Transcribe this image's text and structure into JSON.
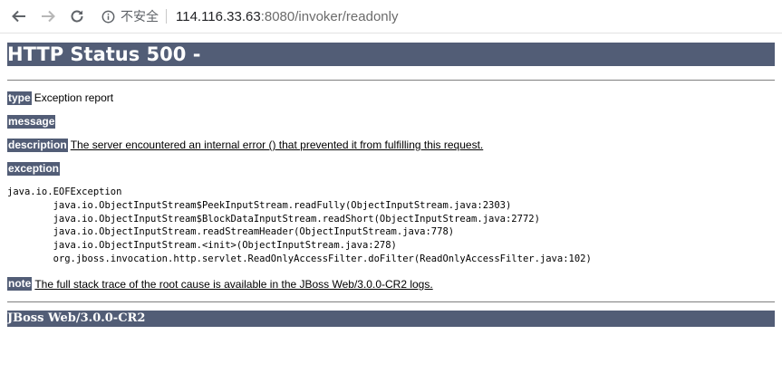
{
  "browser": {
    "back_icon": "arrow-left-icon",
    "forward_icon": "arrow-right-icon",
    "reload_icon": "reload-icon",
    "security_icon": "info-icon",
    "security_label": "不安全",
    "url_host": "114.116.33.63",
    "url_rest": ":8080/invoker/readonly"
  },
  "page": {
    "title": "HTTP Status 500 -",
    "type_label": "type",
    "type_value": "Exception report",
    "message_label": "message",
    "description_label": "description",
    "description_value": "The server encountered an internal error () that prevented it from fulfilling this request.",
    "exception_label": "exception",
    "stack_trace": [
      "java.io.EOFException",
      "\tjava.io.ObjectInputStream$PeekInputStream.readFully(ObjectInputStream.java:2303)",
      "\tjava.io.ObjectInputStream$BlockDataInputStream.readShort(ObjectInputStream.java:2772)",
      "\tjava.io.ObjectInputStream.readStreamHeader(ObjectInputStream.java:778)",
      "\tjava.io.ObjectInputStream.<init>(ObjectInputStream.java:278)",
      "\torg.jboss.invocation.http.servlet.ReadOnlyAccessFilter.doFilter(ReadOnlyAccessFilter.java:102)"
    ],
    "note_label": "note",
    "note_value": "The full stack trace of the root cause is available in the JBoss Web/3.0.0-CR2 logs.",
    "footer": "JBoss Web/3.0.0-CR2"
  },
  "colors": {
    "header_bg": "#525d76",
    "header_text": "#ffffff"
  }
}
